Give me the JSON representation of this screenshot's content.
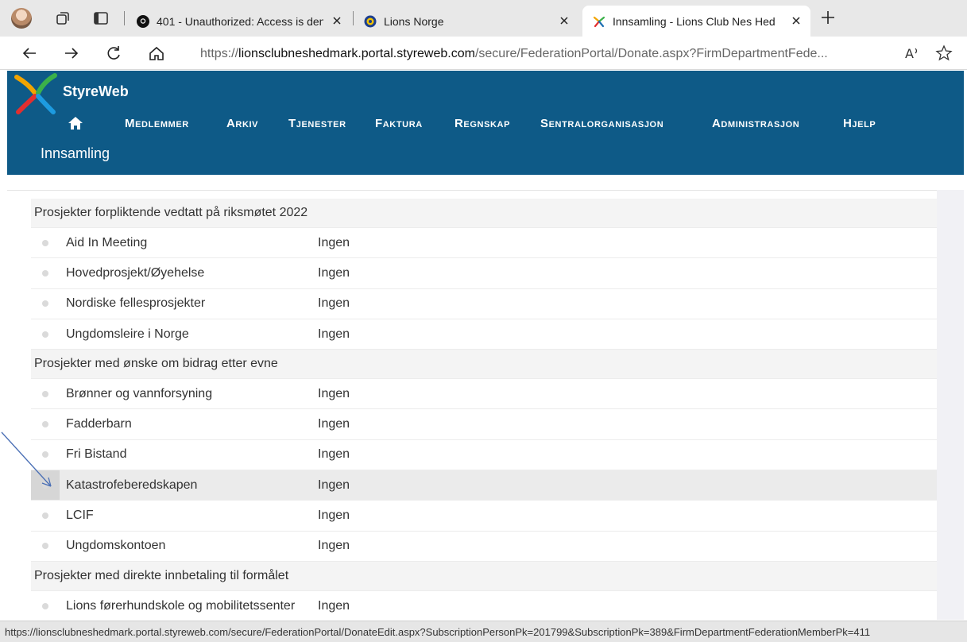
{
  "browser": {
    "tabs": [
      {
        "title": "401 - Unauthorized: Access is den",
        "icon": "github-icon"
      },
      {
        "title": "Lions Norge",
        "icon": "lions-icon"
      },
      {
        "title": "Innsamling - Lions Club Nes Hed",
        "icon": "styreweb-icon",
        "active": true
      }
    ],
    "url_prefix": "https://",
    "url_host": "lionsclubneshedmark.portal.styreweb.com",
    "url_path": "/secure/FederationPortal/Donate.aspx?FirmDepartmentFede...",
    "status_url": "https://lionsclubneshedmark.portal.styreweb.com/secure/FederationPortal/DonateEdit.aspx?SubscriptionPersonPk=201799&SubscriptionPk=389&FirmDepartmentFederationMemberPk=411"
  },
  "app": {
    "brand": "StyreWeb",
    "nav": [
      "Medlemmer",
      "Arkiv",
      "Tjenester",
      "Faktura",
      "Regnskap",
      "Sentralorganisasjon",
      "Administrasjon",
      "Hjelp"
    ],
    "subnav": "Innsamling",
    "colors": {
      "header": "#0e5a87",
      "highlight_row": "#ebebeb"
    }
  },
  "groups": [
    {
      "title": "Prosjekter forpliktende vedtatt på riksmøtet 2022",
      "items": [
        {
          "name": "Aid In Meeting",
          "amount": "Ingen"
        },
        {
          "name": "Hovedprosjekt/Øyehelse",
          "amount": "Ingen"
        },
        {
          "name": "Nordiske fellesprosjekter",
          "amount": "Ingen"
        },
        {
          "name": "Ungdomsleire i Norge",
          "amount": "Ingen"
        }
      ]
    },
    {
      "title": "Prosjekter med ønske om bidrag etter evne",
      "items": [
        {
          "name": "Brønner og vannforsyning",
          "amount": "Ingen"
        },
        {
          "name": "Fadderbarn",
          "amount": "Ingen"
        },
        {
          "name": "Fri Bistand",
          "amount": "Ingen"
        },
        {
          "name": "Katastrofeberedskapen",
          "amount": "Ingen",
          "highlight": true
        },
        {
          "name": "LCIF",
          "amount": "Ingen"
        },
        {
          "name": "Ungdomskontoen",
          "amount": "Ingen"
        }
      ]
    },
    {
      "title": "Prosjekter med direkte innbetaling til formålet",
      "items": [
        {
          "name": "Lions førerhundskole og mobilitetssenter",
          "amount": "Ingen"
        }
      ]
    }
  ]
}
